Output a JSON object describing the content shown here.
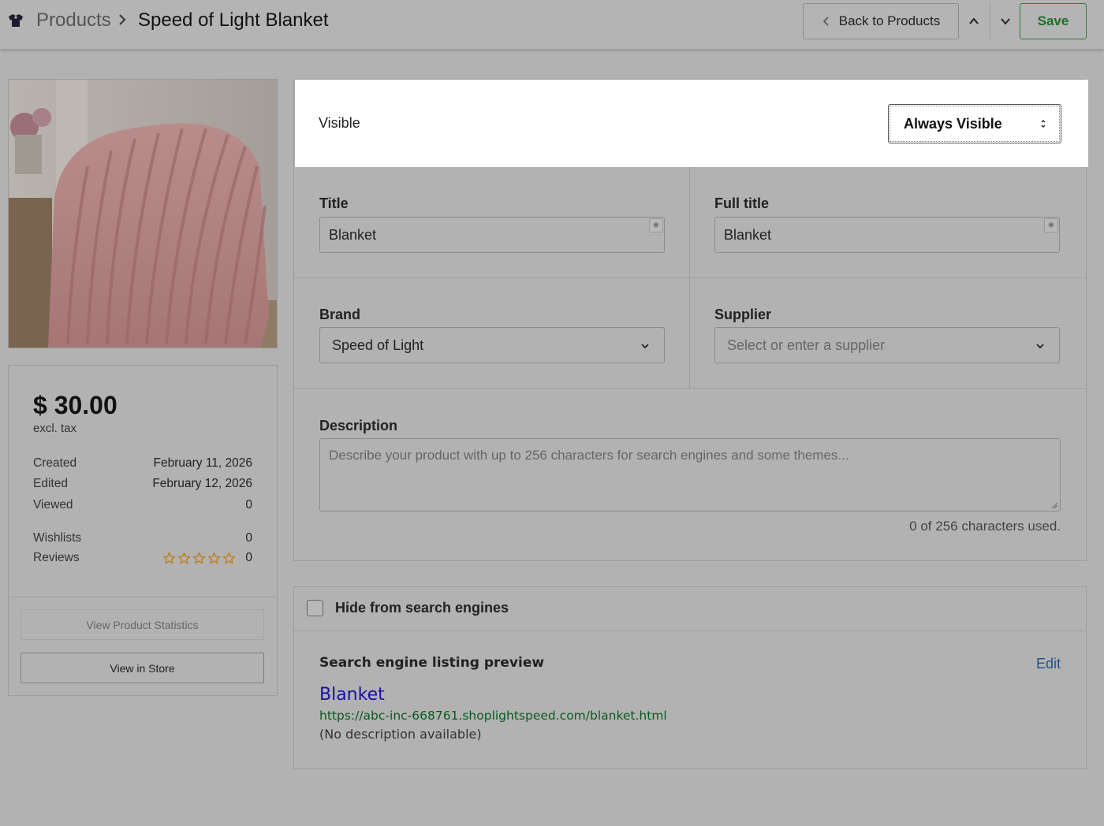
{
  "header": {
    "breadcrumb_root": "Products",
    "breadcrumb_current": "Speed of Light Blanket",
    "back_label": "Back to Products",
    "save_label": "Save",
    "save_color": "#1f6e2b"
  },
  "product": {
    "image_alt": "Pink ribbed faux fur blanket draped over a chair"
  },
  "stats": {
    "price": "$ 30.00",
    "price_note": "excl. tax",
    "rows": [
      {
        "label": "Created",
        "value": "February 11, 2026"
      },
      {
        "label": "Edited",
        "value": "February 12, 2026"
      },
      {
        "label": "Viewed",
        "value": "0"
      },
      {
        "label": "Wishlists",
        "value": "0"
      },
      {
        "label": "Reviews",
        "value": "0"
      }
    ],
    "review_stars_filled": 0,
    "review_stars_total": 5,
    "star_color": "#c07a10",
    "view_statistics_label": "View Product Statistics",
    "view_in_store_label": "View in Store"
  },
  "form": {
    "visible_label": "Visible",
    "visible_value": "Always Visible",
    "title_label": "Title",
    "title_value": "Blanket",
    "full_title_label": "Full title",
    "full_title_value": "Blanket",
    "brand_label": "Brand",
    "brand_value": "Speed of Light",
    "supplier_label": "Supplier",
    "supplier_placeholder": "Select or enter a supplier",
    "description_label": "Description",
    "description_placeholder": "Describe your product with up to 256 characters for search engines and some themes...",
    "char_count": "0 of 256 characters used."
  },
  "seo": {
    "hide_label": "Hide from search engines",
    "hide_checked": false,
    "preview_heading": "Search engine listing preview",
    "edit_label": "Edit",
    "preview_title": "Blanket",
    "preview_url": "https://abc-inc-668761.shoplightspeed.com/blanket.html",
    "preview_description": "(No description available)",
    "link_color": "#1a0dab",
    "url_color": "#0b5a1f"
  }
}
